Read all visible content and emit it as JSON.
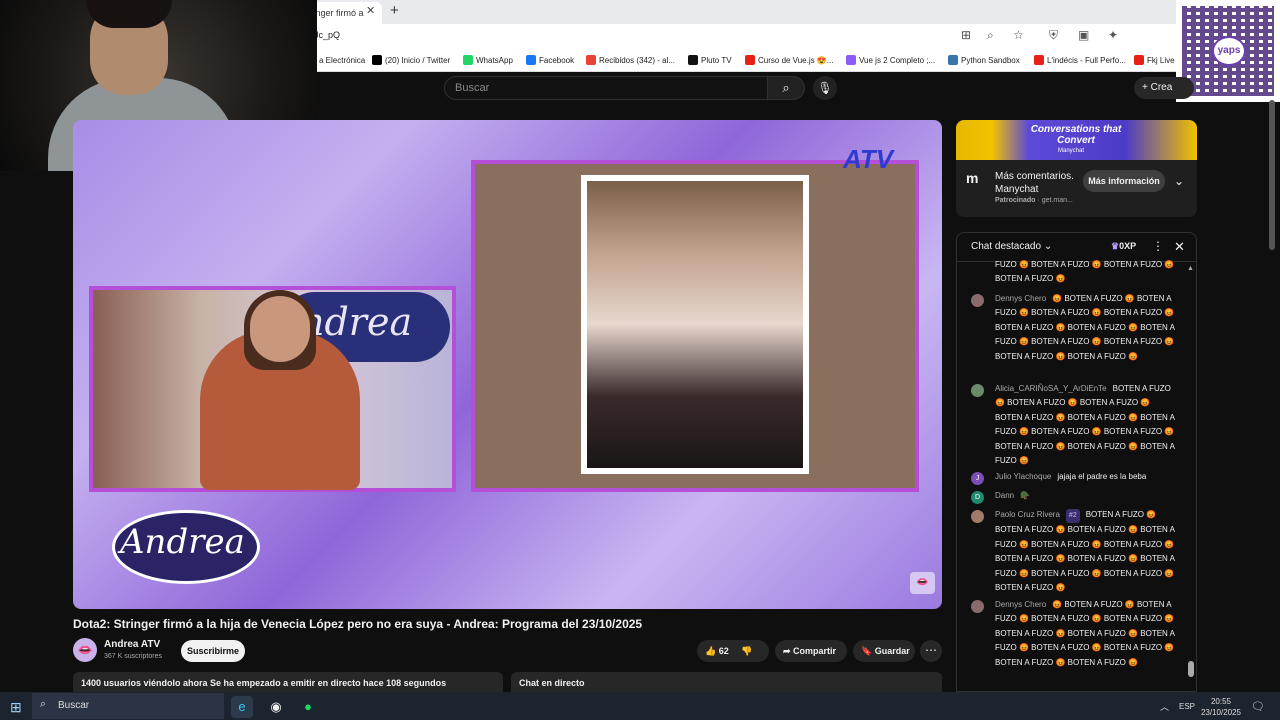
{
  "browser": {
    "tab_title": "tringer firmó a",
    "url": "Jc_pQ",
    "bookmarks": [
      {
        "label": "a Electrónica",
        "color": "#888888"
      },
      {
        "label": "(20) Inicio / Twitter",
        "color": "#000000"
      },
      {
        "label": "WhatsApp",
        "color": "#25d366"
      },
      {
        "label": "Facebook",
        "color": "#1877f2"
      },
      {
        "label": "Recibidos (342) - al...",
        "color": "#ea4335"
      },
      {
        "label": "Pluto TV",
        "color": "#111111"
      },
      {
        "label": "Curso de Vue.js 😍...",
        "color": "#e62117"
      },
      {
        "label": "Vue js 2 Completo ;...",
        "color": "#8b5cf6"
      },
      {
        "label": "Python Sandbox",
        "color": "#3776ab"
      },
      {
        "label": "L'indécis - Full Perfo...",
        "color": "#e62117"
      },
      {
        "label": "Fkj Live",
        "color": "#e62117"
      }
    ]
  },
  "overlay": {
    "qr_label": "yaps"
  },
  "youtube": {
    "search_placeholder": "Buscar",
    "create_label": "Crea",
    "video": {
      "atv_logo": "ATV",
      "andrea_logo": "Andrea",
      "andrea_set_logo": "ndrea"
    },
    "title": "Dota2: Stringer firmó a la hija de Venecia López pero no era suya - Andrea: Programa del 23/10/2025",
    "channel": {
      "name": "Andrea ATV",
      "subscribers": "367 K suscriptores"
    },
    "subscribe_label": "Suscribirme",
    "likes": "62",
    "share_label": "Compartir",
    "save_label": "Guardar",
    "info_text": "1400 usuarios viéndolo ahora  Se ha empezado a emitir en directo hace 108 segundos",
    "chat_live_label": "Chat en directo"
  },
  "ad": {
    "headline": "Conversations that Convert",
    "brand_small": "Manychat",
    "title": "Más comentarios. Manychat",
    "sponsor_label": "Patrocinado",
    "sponsor_domain": "get.man...",
    "cta": "Más información"
  },
  "chat": {
    "title": "Chat destacado",
    "xp": "0XP",
    "messages": [
      {
        "author": "",
        "text": "FUZO 😡 BOTEN A FUZO 😡 BOTEN A FUZO 😡 BOTEN A FUZO 😡",
        "avatar_color": "#333333",
        "avatar_letter": ""
      },
      {
        "author": "Dennys Chero",
        "text": "😡 BOTEN A FUZO 😡 BOTEN A FUZO 😡 BOTEN A FUZO 😡 BOTEN A FUZO 😡 BOTEN A FUZO 😡 BOTEN A FUZO 😡 BOTEN A FUZO 😡 BOTEN A FUZO 😡 BOTEN A FUZO 😡 BOTEN A FUZO 😡 BOTEN A FUZO 😡",
        "avatar_color": "#8a6b6b",
        "avatar_letter": ""
      },
      {
        "author": "Alicia_CARIÑoSA_Y_ArDiEnTe",
        "text": "BOTEN A FUZO 😡 BOTEN A FUZO 😡 BOTEN A FUZO 😡 BOTEN A FUZO 😡 BOTEN A FUZO 😡 BOTEN A FUZO 😡 BOTEN A FUZO 😡 BOTEN A FUZO 😡 BOTEN A FUZO 😡 BOTEN A FUZO 😡 BOTEN A FUZO 😡",
        "avatar_color": "#6a8a6a",
        "avatar_letter": ""
      },
      {
        "author": "Julio Ylachoque",
        "text": "jajaja el padre es la beba",
        "avatar_color": "#7b4fb5",
        "avatar_letter": "J"
      },
      {
        "author": "Dann",
        "text": "🪖",
        "avatar_color": "#1f8a6e",
        "avatar_letter": "D"
      },
      {
        "author": "Paolo Cruz Rivera",
        "badge": "#2",
        "text": "BOTEN A FUZO 😡 BOTEN A FUZO 😡 BOTEN A FUZO 😡 BOTEN A FUZO 😡 BOTEN A FUZO 😡 BOTEN A FUZO 😡 BOTEN A FUZO 😡 BOTEN A FUZO 😡 BOTEN A FUZO 😡 BOTEN A FUZO 😡 BOTEN A FUZO 😡 BOTEN A FUZO 😡",
        "avatar_color": "#a07a6a",
        "avatar_letter": ""
      },
      {
        "author": "Dennys Chero",
        "text": "😡 BOTEN A FUZO 😡 BOTEN A FUZO 😡 BOTEN A FUZO 😡 BOTEN A FUZO 😡 BOTEN A FUZO 😡 BOTEN A FUZO 😡 BOTEN A FUZO 😡 BOTEN A FUZO 😡 BOTEN A FUZO 😡 BOTEN A FUZO 😡 BOTEN A FUZO 😡",
        "avatar_color": "#8a6b6b",
        "avatar_letter": ""
      }
    ]
  },
  "taskbar": {
    "search_label": "Buscar",
    "lang": "ESP",
    "time": "20:55",
    "date": "23/10/2025"
  }
}
